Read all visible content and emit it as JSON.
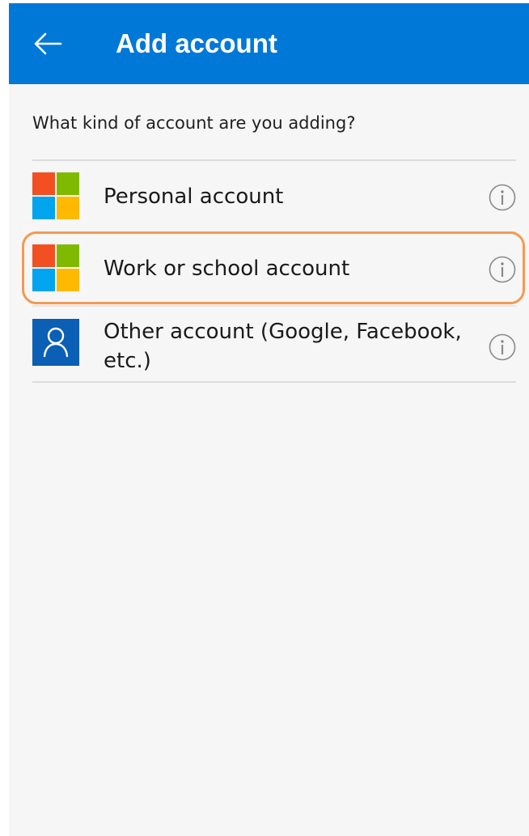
{
  "header": {
    "back_icon": "arrow-left-icon",
    "title": "Add account"
  },
  "prompt": "What kind of account are you adding?",
  "accounts": [
    {
      "label": "Personal account",
      "icon": "microsoft-logo",
      "info_icon": "info-icon"
    },
    {
      "label": "Work or school account",
      "icon": "microsoft-logo",
      "info_icon": "info-icon",
      "highlighted": true
    },
    {
      "label": "Other account (Google, Facebook, etc.)",
      "icon": "person-icon",
      "info_icon": "info-icon"
    }
  ],
  "colors": {
    "app_bar": "#0078d7",
    "background": "#f6f6f6",
    "highlight": "#f39a52",
    "ms_red": "#f25022",
    "ms_green": "#7fba00",
    "ms_blue": "#00a4ef",
    "ms_yellow": "#ffb900",
    "person_tile": "#0b5fb5"
  }
}
